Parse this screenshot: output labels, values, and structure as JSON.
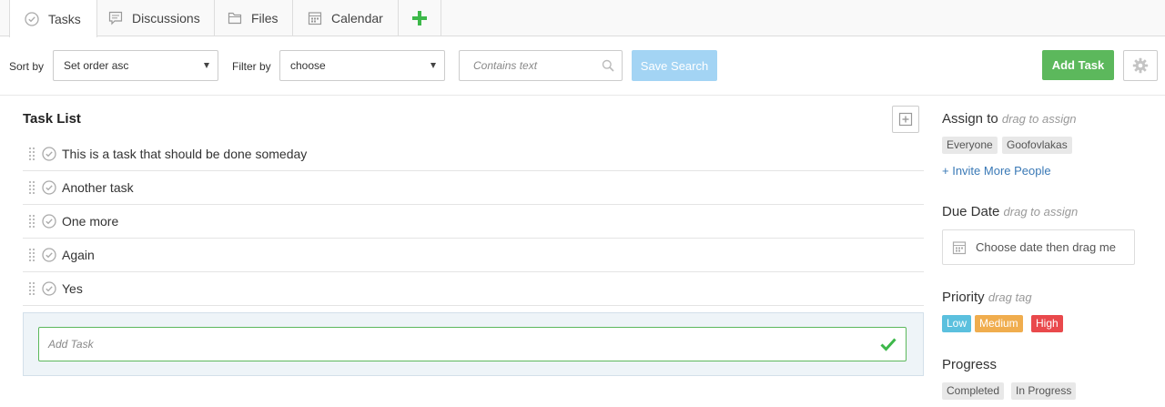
{
  "tabs": [
    {
      "label": "Tasks",
      "icon": "check-circle-icon",
      "active": true
    },
    {
      "label": "Discussions",
      "icon": "comment-icon"
    },
    {
      "label": "Files",
      "icon": "folder-icon"
    },
    {
      "label": "Calendar",
      "icon": "calendar-icon"
    }
  ],
  "add_tab_icon": "plus-icon",
  "toolbar": {
    "sort_label": "Sort by",
    "sort_value": "Set order asc",
    "filter_label": "Filter by",
    "filter_value": "choose",
    "search_placeholder": "Contains text",
    "save_search": "Save Search",
    "add_task": "Add Task"
  },
  "task_list": {
    "title": "Task List",
    "tasks": [
      "This is a task that should be done someday",
      "Another task",
      "One more",
      "Again",
      "Yes"
    ],
    "add_placeholder": "Add Task"
  },
  "sidebar": {
    "assign": {
      "title": "Assign to",
      "hint": "drag to assign",
      "chips": [
        "Everyone",
        "Goofovlakas"
      ],
      "invite": "+ Invite More People"
    },
    "due": {
      "title": "Due Date",
      "hint": "drag to assign",
      "placeholder": "Choose date then drag me"
    },
    "priority": {
      "title": "Priority",
      "hint": "drag tag",
      "tags": [
        {
          "label": "Low",
          "color": "#5bc0de"
        },
        {
          "label": "Medium",
          "color": "#f0ad4e"
        },
        {
          "label": "High",
          "color": "#e9494c"
        }
      ]
    },
    "progress": {
      "title": "Progress",
      "chips": [
        "Completed",
        "In Progress"
      ]
    }
  },
  "colors": {
    "accent_green": "#5cb85c",
    "link_blue": "#3a79b6",
    "save_button": "#a3d4f4"
  }
}
